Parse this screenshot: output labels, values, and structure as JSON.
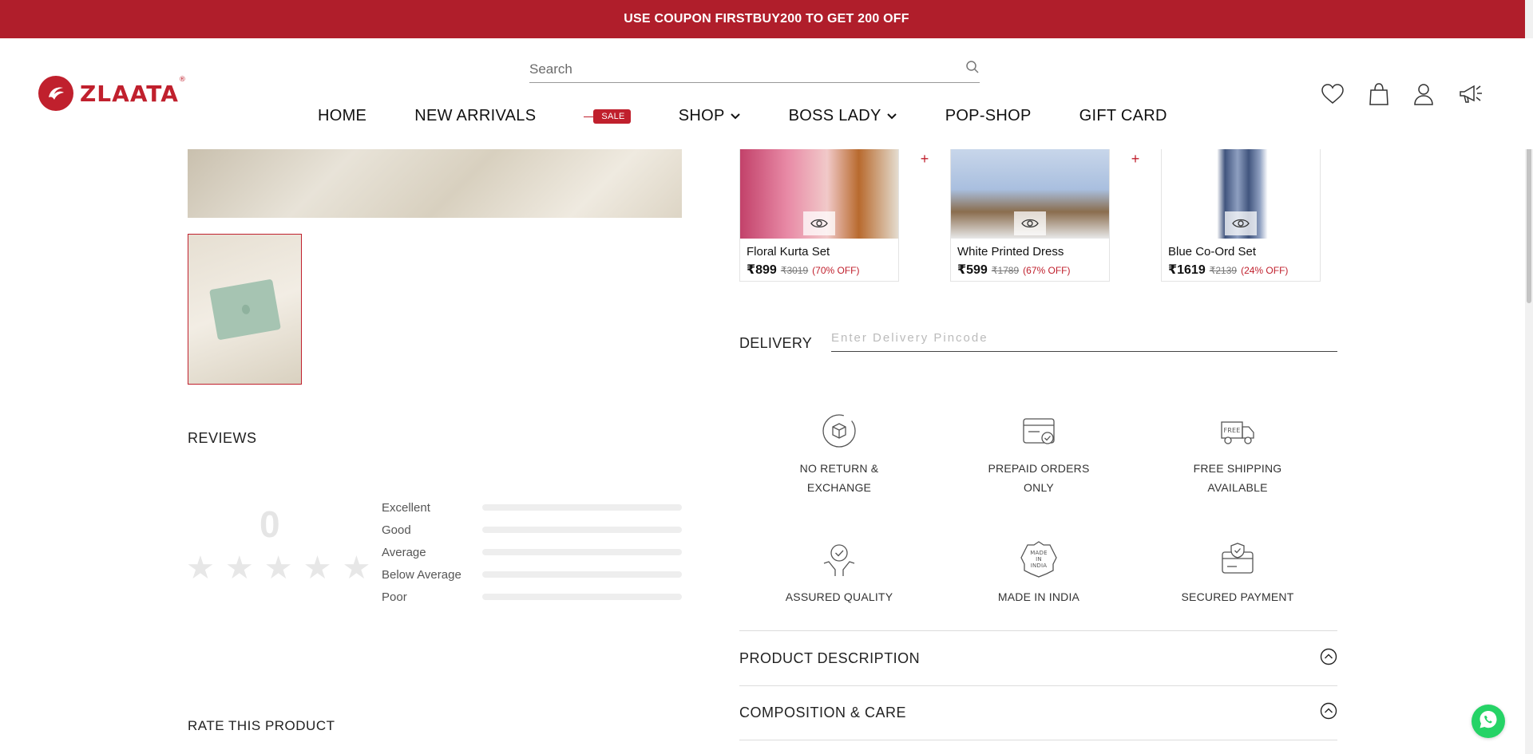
{
  "promo": {
    "text": "USE COUPON FIRSTBUY200 TO GET 200 OFF"
  },
  "brand": {
    "name": "ZLAATA",
    "registered": "®",
    "color": "#c0202d"
  },
  "search": {
    "placeholder": "Search",
    "icon": "search-icon"
  },
  "nav": {
    "items": [
      {
        "label": "HOME"
      },
      {
        "label": "NEW ARRIVALS"
      },
      {
        "label": "SALE"
      },
      {
        "label": "SHOP"
      },
      {
        "label": "BOSS LADY"
      },
      {
        "label": "POP-SHOP"
      },
      {
        "label": "GIFT CARD"
      }
    ]
  },
  "header_icons": [
    "heart-icon",
    "bag-icon",
    "user-icon",
    "megaphone-icon"
  ],
  "related_products": [
    {
      "name": "Floral Kurta Set",
      "price": "₹899",
      "old_price": "₹3019",
      "discount": "(70% OFF)"
    },
    {
      "name": "White Printed Dress",
      "price": "₹599",
      "old_price": "₹1789",
      "discount": "(67% OFF)"
    },
    {
      "name": "Blue Co-Ord Set",
      "price": "₹1619",
      "old_price": "₹2139",
      "discount": "(24% OFF)"
    }
  ],
  "delivery": {
    "label": "DELIVERY",
    "placeholder": "Enter Delivery Pincode"
  },
  "features": [
    {
      "line1": "NO RETURN &",
      "line2": "EXCHANGE",
      "icon": "box-return-icon"
    },
    {
      "line1": "PREPAID ORDERS",
      "line2": "ONLY",
      "icon": "card-check-icon"
    },
    {
      "line1": "FREE SHIPPING",
      "line2": "AVAILABLE",
      "icon": "truck-icon"
    },
    {
      "line1": "ASSURED QUALITY",
      "line2": "",
      "icon": "quality-badge-icon"
    },
    {
      "line1": "MADE IN INDIA",
      "line2": "",
      "icon": "made-in-india-icon"
    },
    {
      "line1": "SECURED PAYMENT",
      "line2": "",
      "icon": "secure-card-icon"
    }
  ],
  "feature_badges": {
    "free": "FREE",
    "made": "MADE",
    "in": "IN",
    "india": "INDIA"
  },
  "reviews": {
    "title": "REVIEWS",
    "score": "0",
    "rows": [
      {
        "label": "Excellent",
        "fraction": 0
      },
      {
        "label": "Good",
        "fraction": 0
      },
      {
        "label": "Average",
        "fraction": 0
      },
      {
        "label": "Below Average",
        "fraction": 0
      },
      {
        "label": "Poor",
        "fraction": 0
      }
    ],
    "stars_filled": 0,
    "stars_total": 5
  },
  "rate": {
    "title": "RATE THIS PRODUCT"
  },
  "accordion": [
    {
      "label": "PRODUCT DESCRIPTION"
    },
    {
      "label": "COMPOSITION & CARE"
    }
  ]
}
